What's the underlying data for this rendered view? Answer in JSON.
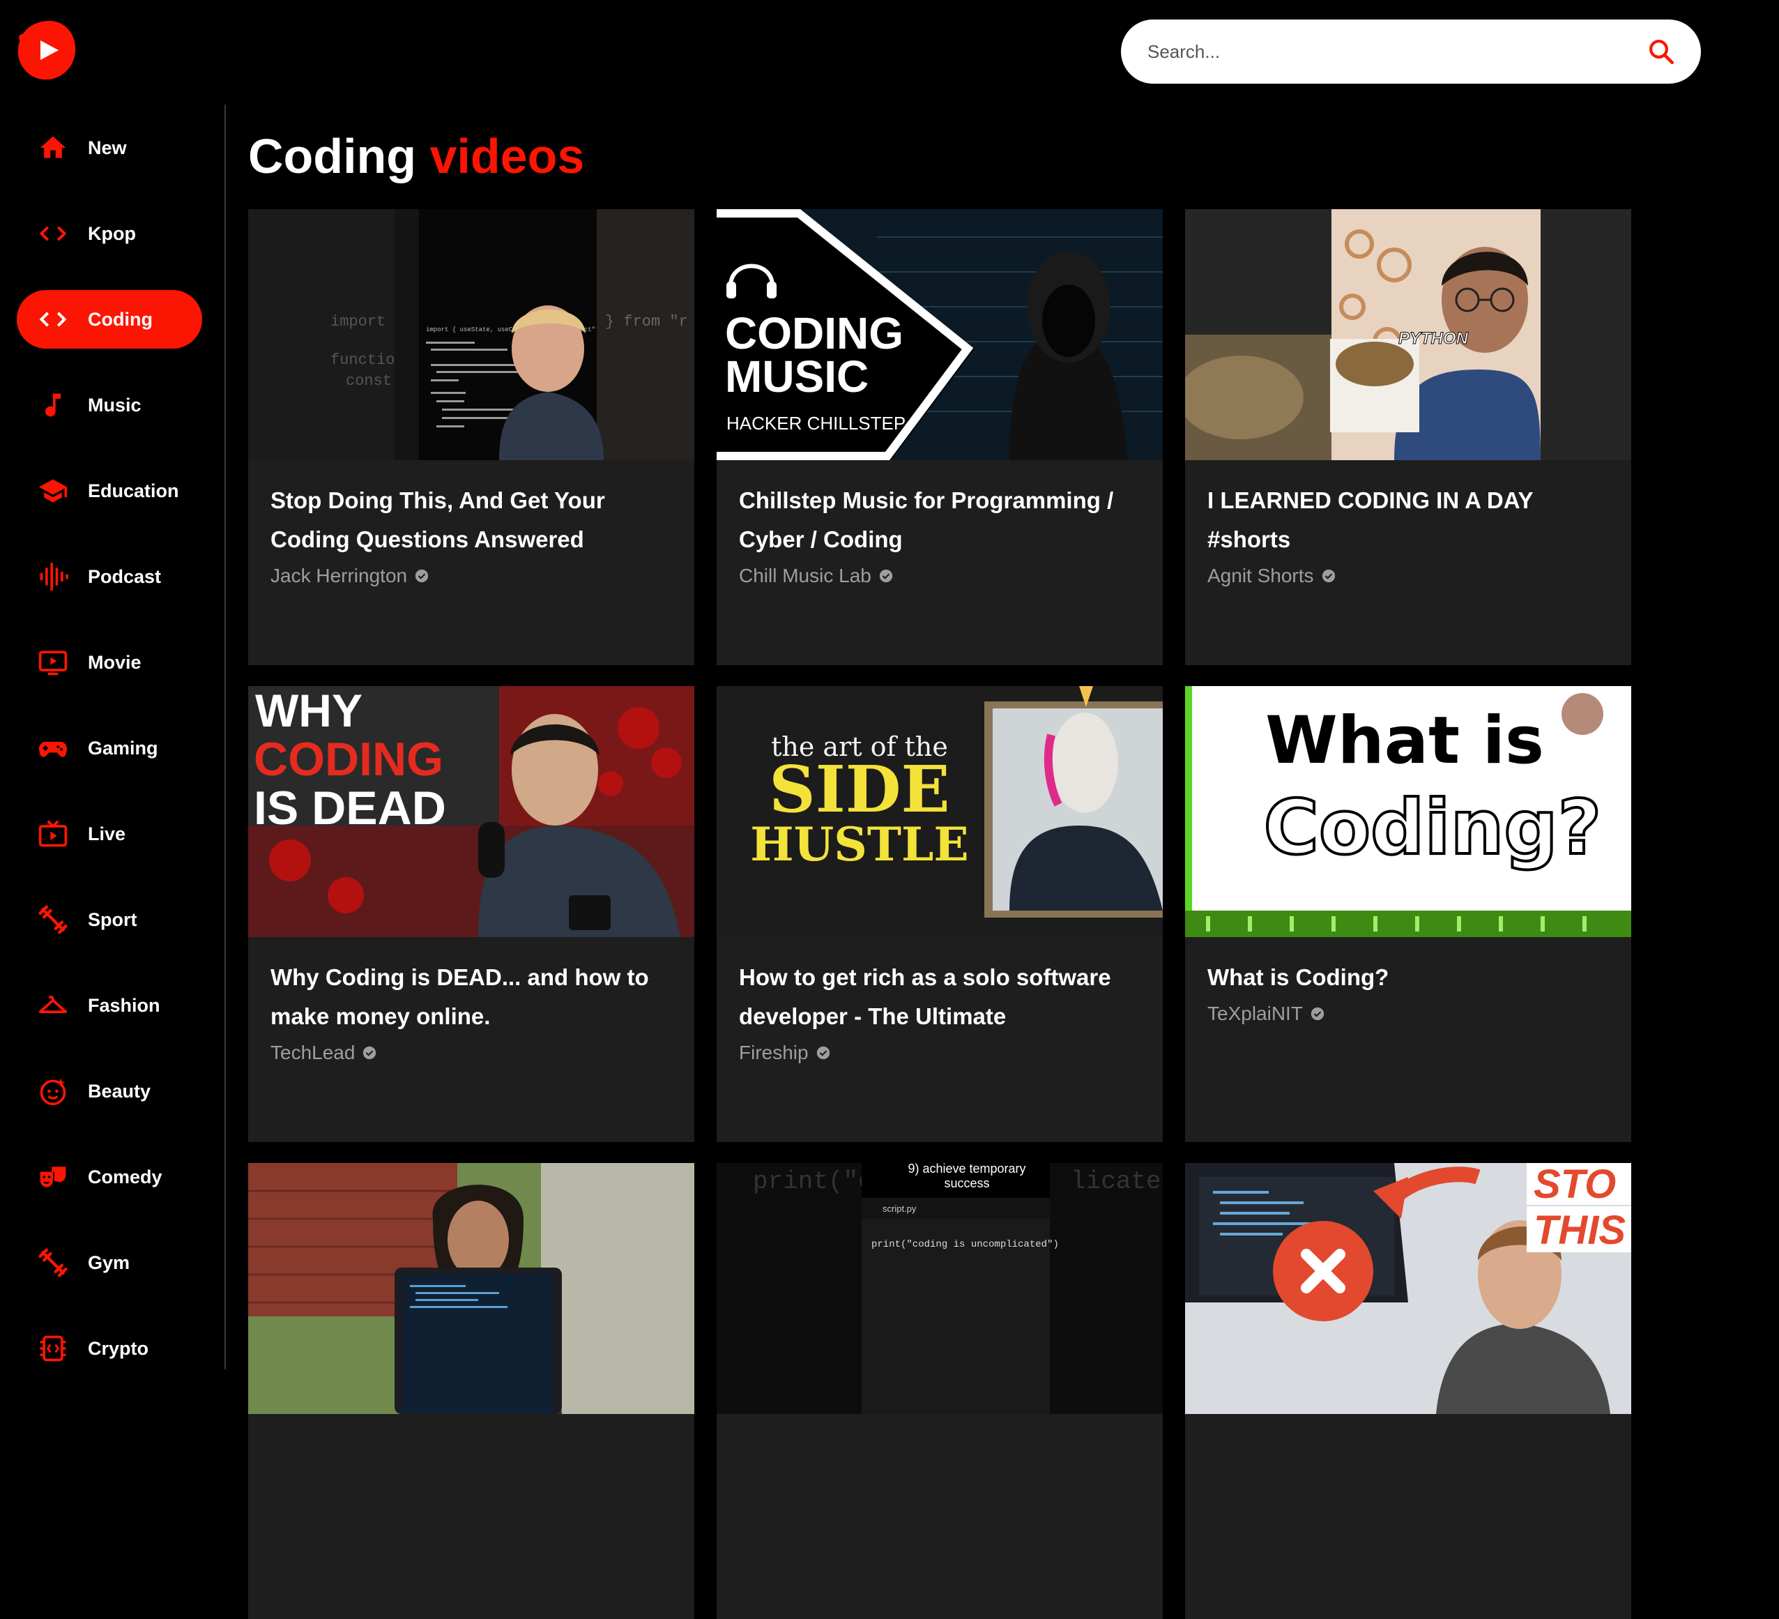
{
  "search": {
    "placeholder": "Search..."
  },
  "header": {
    "title_main": "Coding",
    "title_accent": "videos"
  },
  "colors": {
    "accent": "#fc1503",
    "card_bg": "#1e1e1e",
    "background": "#000000",
    "channel_text": "#9e9e9e"
  },
  "sidebar": {
    "items": [
      {
        "label": "New",
        "icon": "home-icon"
      },
      {
        "label": "Kpop",
        "icon": "code-icon"
      },
      {
        "label": "Coding",
        "icon": "code-icon",
        "active": true
      },
      {
        "label": "Music",
        "icon": "music-note-icon"
      },
      {
        "label": "Education",
        "icon": "graduation-cap-icon"
      },
      {
        "label": "Podcast",
        "icon": "sound-wave-icon"
      },
      {
        "label": "Movie",
        "icon": "tv-play-icon"
      },
      {
        "label": "Gaming",
        "icon": "gamepad-icon"
      },
      {
        "label": "Live",
        "icon": "live-tv-icon"
      },
      {
        "label": "Sport",
        "icon": "fitness-icon"
      },
      {
        "label": "Fashion",
        "icon": "hanger-icon"
      },
      {
        "label": "Beauty",
        "icon": "face-icon"
      },
      {
        "label": "Comedy",
        "icon": "theater-masks-icon"
      },
      {
        "label": "Gym",
        "icon": "fitness-icon"
      },
      {
        "label": "Crypto",
        "icon": "developer-board-icon"
      }
    ]
  },
  "videos": [
    {
      "title": "Stop Doing This, And Get Your Coding Questions Answered",
      "channel": "Jack Herrington",
      "thumb_text": {
        "code_a": "import",
        "code_b": "functio",
        "code_c": "const",
        "code_d": "} from \"r",
        "code_e": "import { useState, useCallback } from \"react\""
      }
    },
    {
      "title": "Chillstep Music for Programming / Cyber / Coding",
      "channel": "Chill Music Lab",
      "thumb_text": {
        "line1": "CODING",
        "line2": "MUSIC",
        "line3": "HACKER CHILLSTEP"
      }
    },
    {
      "title": "I LEARNED CODING IN A DAY #shorts",
      "channel": "Agnit Shorts",
      "thumb_text": {
        "tag": "PYTHON"
      }
    },
    {
      "title": "Why Coding is DEAD... and how to make money online.",
      "channel": "TechLead",
      "thumb_text": {
        "line1": "WHY",
        "line2": "CODING",
        "line3": "IS DEAD"
      }
    },
    {
      "title": "How to get rich as a solo software developer - The Ultimate",
      "channel": "Fireship",
      "thumb_text": {
        "line1": "the art of the",
        "line2": "SIDE",
        "line3": "HUSTLE"
      }
    },
    {
      "title": "What is Coding?",
      "channel": "TeXplaiNIT",
      "thumb_text": {
        "line1": "What is",
        "line2": "Coding?"
      }
    },
    {
      "title": "",
      "channel": "",
      "thumb_text": {}
    },
    {
      "title": "",
      "channel": "",
      "thumb_text": {
        "caption1": "9) achieve temporary",
        "caption2": "success",
        "file": "script.py",
        "code": "print(\"coding is uncomplicated\")",
        "bg_left": "print(\"c",
        "bg_right": "licated"
      }
    },
    {
      "title": "",
      "channel": "",
      "thumb_text": {
        "line1": "STO",
        "line2": "THIS"
      }
    }
  ]
}
